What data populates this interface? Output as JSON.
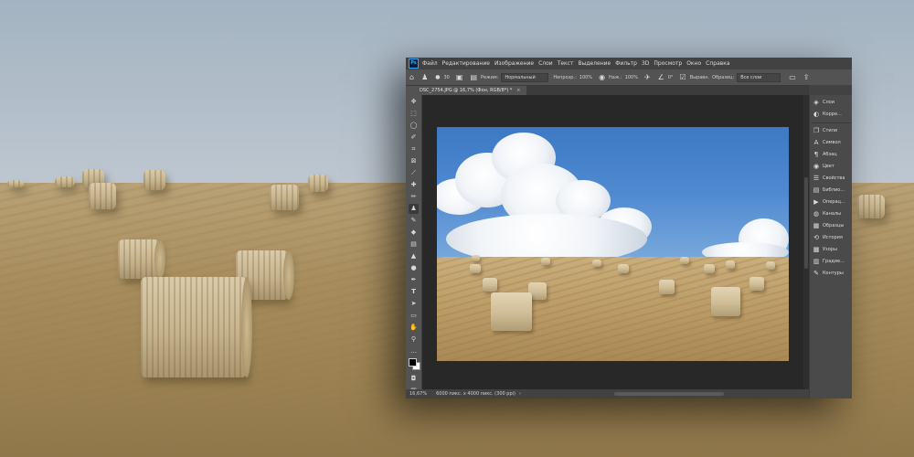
{
  "menubar": {
    "logo": "Ps",
    "items": [
      "Файл",
      "Редактирование",
      "Изображение",
      "Слои",
      "Текст",
      "Выделение",
      "Фильтр",
      "3D",
      "Просмотр",
      "Окно",
      "Справка"
    ]
  },
  "options": {
    "brush_size": "30",
    "mode_label": "Режим:",
    "mode_value": "Нормальный",
    "opacity_label": "Непрозр.:",
    "opacity_value": "100%",
    "flow_label": "Наж.:",
    "flow_value": "100%",
    "angle_value": "0°",
    "align_label": "Выравн.",
    "sample_label": "Образец:",
    "sample_value": "Все слои"
  },
  "document": {
    "tab_title": "DSC_2754.JPG @ 16,7% (Фон, RGB/8*) *",
    "close_glyph": "×"
  },
  "status": {
    "zoom": "16,67%",
    "info": "6000 пикс. x 4000 пикс. (300 ppi)"
  },
  "panels": [
    {
      "icon": "layers-icon",
      "glyph": "◈",
      "label": "Слои"
    },
    {
      "icon": "adjustments-icon",
      "glyph": "◐",
      "label": "Корре..."
    },
    {
      "icon": "layers-icon",
      "glyph": "❐",
      "label": "Стили"
    },
    {
      "icon": "character-icon",
      "glyph": "A",
      "label": "Символ"
    },
    {
      "icon": "paragraph-icon",
      "glyph": "¶",
      "label": "Абзац"
    },
    {
      "icon": "color-icon",
      "glyph": "◉",
      "label": "Цвет"
    },
    {
      "icon": "properties-icon",
      "glyph": "☰",
      "label": "Свойства"
    },
    {
      "icon": "libraries-icon",
      "glyph": "▤",
      "label": "Библио..."
    },
    {
      "icon": "actions-icon",
      "glyph": "▶",
      "label": "Операц..."
    },
    {
      "icon": "channels-icon",
      "glyph": "◍",
      "label": "Каналы"
    },
    {
      "icon": "swatches-icon",
      "glyph": "▦",
      "label": "Образцы"
    },
    {
      "icon": "history-icon",
      "glyph": "⟲",
      "label": "История"
    },
    {
      "icon": "patterns-icon",
      "glyph": "▩",
      "label": "Узоры"
    },
    {
      "icon": "gradients-icon",
      "glyph": "▥",
      "label": "Градие..."
    },
    {
      "icon": "paths-icon",
      "glyph": "✎",
      "label": "Контуры"
    }
  ],
  "colors": {
    "accent": "#31a8ff",
    "ui_bg": "#535353",
    "canvas_bg": "#282828",
    "foreground_color": "#000000",
    "background_color": "#ffffff"
  }
}
